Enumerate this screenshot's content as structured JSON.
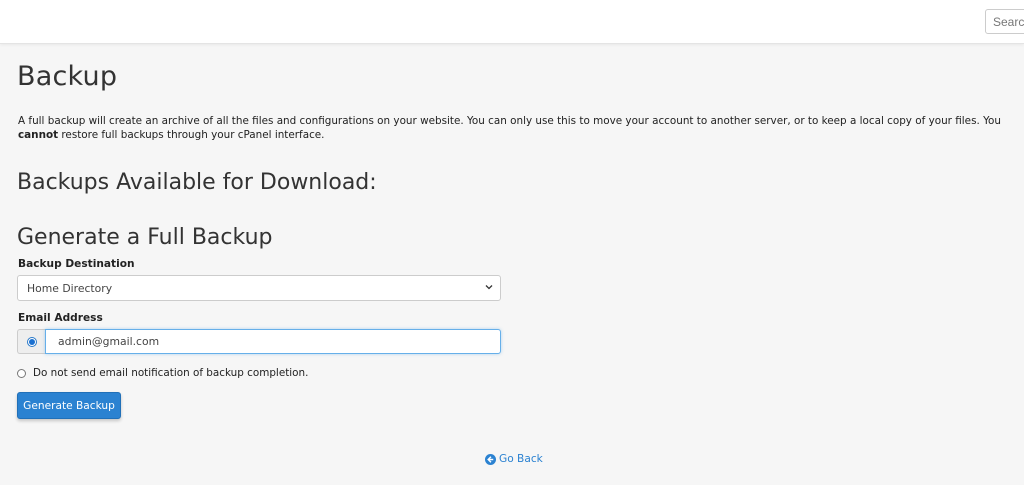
{
  "header": {
    "search_placeholder": "Search"
  },
  "page": {
    "title": "Backup",
    "intro_text": "A full backup will create an archive of all the files and configurations on your website. You can only use this to move your account to another server, or to keep a local copy of your files. You ",
    "intro_emphasis": "cannot",
    "intro_text_end": " restore full backups through your cPanel interface."
  },
  "sections": {
    "available_heading": "Backups Available for Download:",
    "generate_heading": "Generate a Full Backup"
  },
  "form": {
    "destination_label": "Backup Destination",
    "destination_value": "Home Directory",
    "email_label": "Email Address",
    "email_value": "admin@gmail.com",
    "no_email_option": "Do not send email notification of backup completion.",
    "email_option_selected": true,
    "generate_button": "Generate Backup"
  },
  "footer": {
    "go_back": "Go Back"
  },
  "colors": {
    "accent": "#2b82d1",
    "background": "#f6f6f6"
  }
}
